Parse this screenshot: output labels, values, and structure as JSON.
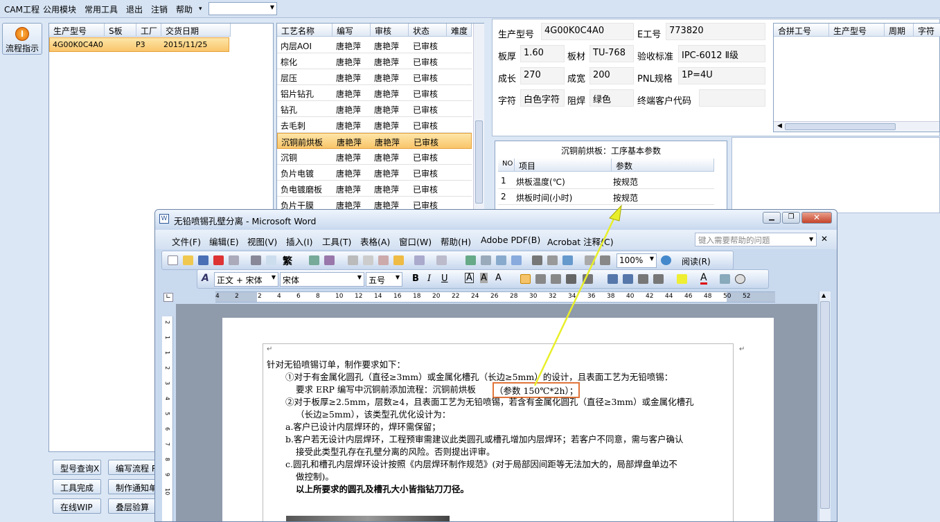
{
  "menubar": {
    "items": [
      "CAM工程",
      "公用模块",
      "常用工具",
      "退出",
      "注销",
      "帮助"
    ],
    "dropdown_arrow": "▾",
    "combo_value": ""
  },
  "side": {
    "flow_button": "流程指示",
    "flow_icon": "power-icon"
  },
  "orders": {
    "headers": [
      "生产型号",
      "S板",
      "工厂",
      "交货日期"
    ],
    "rows": [
      {
        "model": "4G00K0C4A0",
        "s": "",
        "factory": "P3",
        "date": "2015/11/25"
      }
    ]
  },
  "process": {
    "headers": [
      "工艺名称",
      "编写",
      "审核",
      "状态",
      "难度"
    ],
    "rows": [
      {
        "name": "内层AOI",
        "writer": "唐艳萍",
        "reviewer": "唐艳萍",
        "status": "已审核"
      },
      {
        "name": "棕化",
        "writer": "唐艳萍",
        "reviewer": "唐艳萍",
        "status": "已审核"
      },
      {
        "name": "层压",
        "writer": "唐艳萍",
        "reviewer": "唐艳萍",
        "status": "已审核"
      },
      {
        "name": "铝片钻孔",
        "writer": "唐艳萍",
        "reviewer": "唐艳萍",
        "status": "已审核"
      },
      {
        "name": "钻孔",
        "writer": "唐艳萍",
        "reviewer": "唐艳萍",
        "status": "已审核"
      },
      {
        "name": "去毛刺",
        "writer": "唐艳萍",
        "reviewer": "唐艳萍",
        "status": "已审核"
      },
      {
        "name": "沉铜前烘板",
        "writer": "唐艳萍",
        "reviewer": "唐艳萍",
        "status": "已审核"
      },
      {
        "name": "沉铜",
        "writer": "唐艳萍",
        "reviewer": "唐艳萍",
        "status": "已审核"
      },
      {
        "name": "负片电镀",
        "writer": "唐艳萍",
        "reviewer": "唐艳萍",
        "status": "已审核"
      },
      {
        "name": "负电镀磨板",
        "writer": "唐艳萍",
        "reviewer": "唐艳萍",
        "status": "已审核"
      },
      {
        "name": "负片干膜",
        "writer": "唐艳萍",
        "reviewer": "唐艳萍",
        "status": "已审核"
      }
    ]
  },
  "info": {
    "model_label": "生产型号",
    "model": "4G00K0C4A0",
    "e_label": "E工号",
    "e": "773820",
    "thick_label": "板厚",
    "thick": "1.60",
    "material_label": "板材",
    "material": "TU-768",
    "std_label": "验收标准",
    "std": "IPC-6012 Ⅱ级",
    "len_label": "成长",
    "len": "270",
    "wid_label": "成宽",
    "wid": "200",
    "pnl_label": "PNL规格",
    "pnl": "1P=4U",
    "char_label": "字符",
    "char": "白色字符",
    "mask_label": "阻焊",
    "mask": "绿色",
    "cust_label": "终端客户代码",
    "cust": ""
  },
  "merge": {
    "headers": [
      "合拼工号",
      "生产型号",
      "周期",
      "字符"
    ]
  },
  "params": {
    "title": "沉铜前烘板：工序基本参数",
    "headers": [
      "NO",
      "项目",
      "参数"
    ],
    "rows": [
      {
        "no": "1",
        "item": "烘板温度(℃)",
        "value": "按规范"
      },
      {
        "no": "2",
        "item": "烘板时间(小时)",
        "value": "按规范"
      }
    ]
  },
  "buttons": [
    "型号查询X",
    "编写流程 R",
    "工具完成",
    "制作通知单",
    "在线WIP",
    "叠层验算"
  ],
  "word": {
    "title": "无铅喷锡孔壁分离 - Microsoft Word",
    "menu": [
      "文件(F)",
      "编辑(E)",
      "视图(V)",
      "插入(I)",
      "工具(T)",
      "表格(A)",
      "窗口(W)",
      "帮助(H)",
      "Adobe PDF(B)",
      "Acrobat 注释(C)"
    ],
    "help_placeholder": "键入需要帮助的问题",
    "zoom": "100%",
    "read": "阅读(R)",
    "style": "正文 + 宋体",
    "font": "宋体",
    "size": "五号",
    "trad": "繁",
    "ruler": [
      "4",
      "2",
      "2",
      "4",
      "6",
      "8",
      "10",
      "12",
      "14",
      "16",
      "18",
      "20",
      "22",
      "24",
      "26",
      "28",
      "30",
      "32",
      "34",
      "36",
      "38",
      "40",
      "42",
      "44",
      "46",
      "48",
      "50",
      "52"
    ],
    "vruler": [
      "2",
      "1",
      "1",
      "2",
      "3",
      "4",
      "5",
      "6",
      "7",
      "8",
      "9",
      "10"
    ],
    "doc": {
      "l1": "针对无铅喷锡订单，制作要求如下：",
      "l2": "①对于有金属化圆孔（直径≥3mm）或金属化槽孔（长边≥5mm）的设计，且表面工艺为无铅喷锡：",
      "l3a": "要求 ERP 编写中沉铜前添加流程：沉铜前烘板",
      "l3b": "（参数 150℃*2h）；",
      "l4": "②对于板厚≥2.5mm，层数≥4，且表面工艺为无铅喷锡，若含有金属化圆孔（直径≥3mm）或金属化槽孔",
      "l5": "（长边≥5mm），该类型孔优化设计为：",
      "l6": "a.客户已设计内层焊环的，焊环需保留；",
      "l7": "b.客户若无设计内层焊环，工程预审需建议此类圆孔或槽孔增加内层焊环；若客户不同意，需与客户确认",
      "l8": "接受此类型孔存在孔壁分离的风险。否则提出评审。",
      "l9": "c.圆孔和槽孔内层焊环设计按照《内层焊环制作规范》(对于局部因间距等无法加大的，局部焊盘单边不",
      "l10": "做控制)。",
      "l11": "以上所要求的圆孔及槽孔大小皆指钻刀刀径。"
    },
    "para_mark": "↵"
  }
}
